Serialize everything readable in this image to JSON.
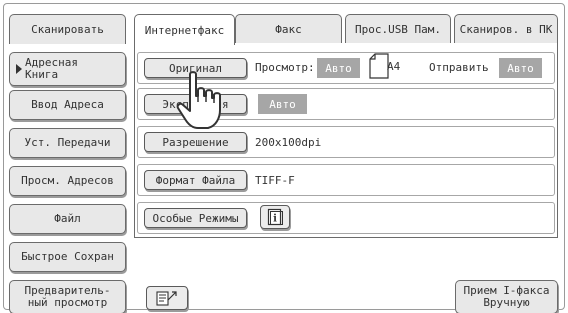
{
  "tabs": [
    {
      "label": "Сканировать",
      "active": false
    },
    {
      "label": "Интернетфакс",
      "active": true
    },
    {
      "label": "Факс",
      "active": false
    },
    {
      "label": "Прос.USB Пам.",
      "active": false
    },
    {
      "label": "Сканиров. в ПК",
      "active": false
    }
  ],
  "sidebar": {
    "address_book": "Адресная\nКнига",
    "address_entry": "Ввод Адреса",
    "transmission_settings": "Уст. Передачи",
    "address_review": "Просм. Адресов",
    "file": "Файл",
    "quick_file": "Быстрое Сохран",
    "preview": "Предваритель-\nный просмотр"
  },
  "main": {
    "original_button": "Оригинал",
    "preview_label": "Просмотр:",
    "preview_value": "Авто",
    "paper_size": "A4",
    "send_label": "Отправить",
    "send_value": "Авто",
    "exposure_button": "Экспозиция",
    "exposure_value": "Авто",
    "resolution_button": "Разрешение",
    "resolution_value": "200x100dpi",
    "file_format_button": "Формат Файла",
    "file_format_value": "TIFF-F",
    "special_modes_button": "Особые Режимы",
    "info_icon_glyph": "i"
  },
  "footer": {
    "manual_receive_button": "Прием I-факса\nВручную"
  },
  "icons": {
    "info": "info-icon",
    "program_recall": "program-edit-icon",
    "pointer": "hand-pointer-icon"
  },
  "colors": {
    "button_bg": "#e8e8e8",
    "auto_badge_bg": "#a6a6a6",
    "border": "#6b6b6b"
  }
}
